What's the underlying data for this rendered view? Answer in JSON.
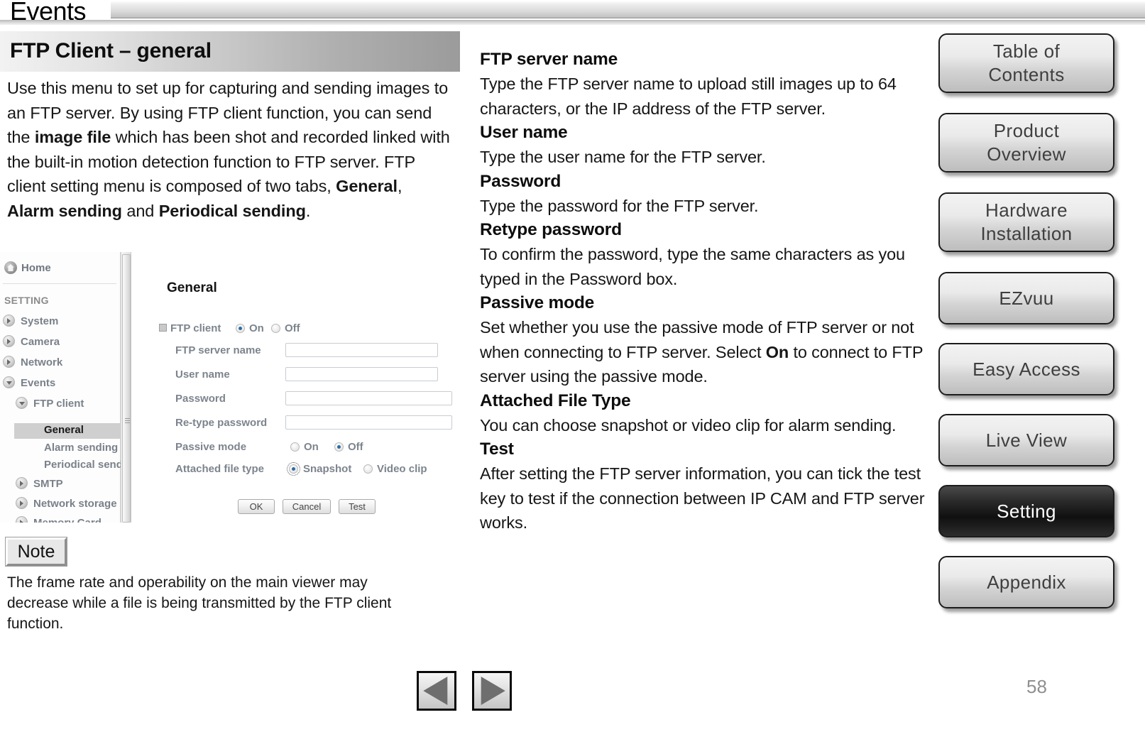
{
  "header": {
    "title": "Events"
  },
  "section": {
    "banner_title": "FTP Client – general",
    "intro_part1": "Use this menu to set up for capturing and sending images to an FTP server. By using FTP client function, you can send the ",
    "intro_bold1": "image file",
    "intro_part2": " which has been shot and recorded linked with the built-in motion detection function to FTP server. FTP client setting menu is composed of two tabs, ",
    "intro_bold2": "General",
    "intro_part3": ", ",
    "intro_bold3": "Alarm sending",
    "intro_part4": " and ",
    "intro_bold4": "Periodical sending",
    "intro_part5": "."
  },
  "embedded_screenshot": {
    "sidebar": {
      "home_label": "Home",
      "setting_label": "SETTING",
      "items": [
        {
          "label": "System",
          "arrow": "right"
        },
        {
          "label": "Camera",
          "arrow": "right"
        },
        {
          "label": "Network",
          "arrow": "right"
        },
        {
          "label": "Events",
          "arrow": "down"
        },
        {
          "label": "FTP client",
          "arrow": "down"
        },
        {
          "label": "General",
          "arrow": "none"
        },
        {
          "label": "Alarm sending",
          "arrow": "none"
        },
        {
          "label": "Periodical send",
          "arrow": "none"
        },
        {
          "label": "SMTP",
          "arrow": "right"
        },
        {
          "label": "Network storage",
          "arrow": "right"
        },
        {
          "label": "Memory Card",
          "arrow": "right"
        }
      ],
      "selected": "General"
    },
    "form": {
      "title": "General",
      "ftp_client_label": "FTP client",
      "ftp_client_on": "On",
      "ftp_client_off": "Off",
      "ftp_client_value": "On",
      "fields": [
        {
          "label": "FTP server name",
          "value": ""
        },
        {
          "label": "User name",
          "value": ""
        },
        {
          "label": "Password",
          "value": ""
        },
        {
          "label": "Re-type password",
          "value": ""
        }
      ],
      "passive_mode_label": "Passive mode",
      "passive_on": "On",
      "passive_off": "Off",
      "passive_value": "Off",
      "attached_label": "Attached file type",
      "attached_snapshot": "Snapshot",
      "attached_video": "Video clip",
      "attached_value": "Snapshot",
      "buttons": {
        "ok": "OK",
        "cancel": "Cancel",
        "test": "Test"
      }
    }
  },
  "note": {
    "label": "Note",
    "text": "The frame rate and operability on the main viewer may decrease while a file is being transmitted by the FTP client function."
  },
  "right_column": {
    "entries": [
      {
        "heading": "FTP server name",
        "body": "Type the FTP server name to upload still images up to 64 characters, or the IP address of the FTP server."
      },
      {
        "heading": "User name",
        "body": "Type the user name for the FTP server."
      },
      {
        "heading": "Password",
        "body": "Type the password for the FTP server."
      },
      {
        "heading": "Retype password",
        "body": "To confirm the password, type the same characters as you typed in the Password box."
      },
      {
        "heading": "Passive mode",
        "body_part1": "Set whether you use the passive mode of FTP server or not when connecting to FTP server. Select ",
        "body_bold": "On",
        "body_part2": " to connect to FTP server using the passive mode."
      },
      {
        "heading": "Attached File Type",
        "body": "You can choose snapshot or video clip for alarm sending."
      },
      {
        "heading": "Test",
        "body": "After setting the FTP server information, you can tick the test key to test if the connection between IP CAM and FTP server works."
      }
    ]
  },
  "right_nav": {
    "buttons": [
      {
        "label": "Table of\nContents",
        "line1": "Table of",
        "line2": "Contents",
        "active": false
      },
      {
        "label": "Product\nOverview",
        "line1": "Product",
        "line2": "Overview",
        "active": false
      },
      {
        "label": "Hardware\nInstallation",
        "line1": "Hardware",
        "line2": "Installation",
        "active": false
      },
      {
        "label": "EZvuu",
        "line1": "EZvuu",
        "line2": "",
        "active": false
      },
      {
        "label": "Easy Access",
        "line1": "Easy Access",
        "line2": "",
        "active": false
      },
      {
        "label": "Live View",
        "line1": "Live View",
        "line2": "",
        "active": false
      },
      {
        "label": "Setting",
        "line1": "Setting",
        "line2": "",
        "active": true
      },
      {
        "label": "Appendix",
        "line1": "Appendix",
        "line2": "",
        "active": false
      }
    ]
  },
  "footer": {
    "prev_icon": "triangle-left-icon",
    "next_icon": "triangle-right-icon",
    "page_number": "58"
  }
}
